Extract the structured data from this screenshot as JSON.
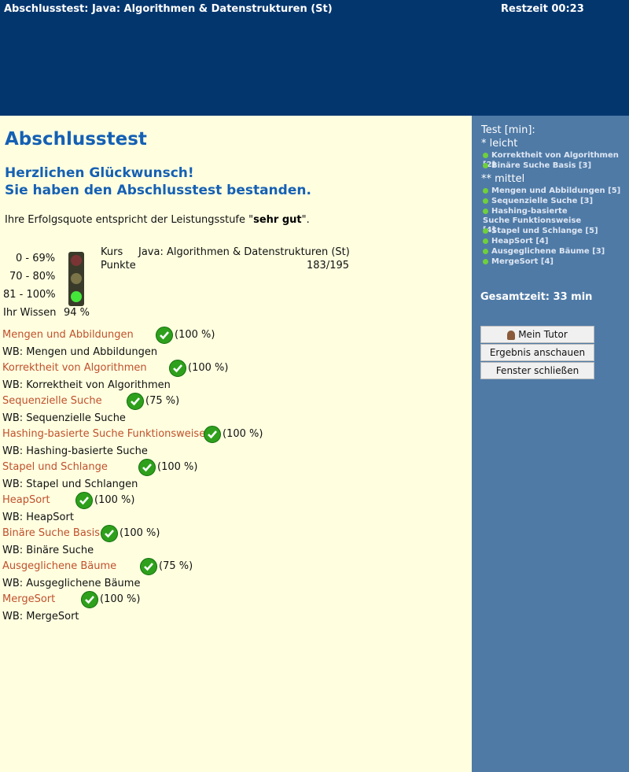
{
  "header": {
    "title": "Abschlusstest: Java: Algorithmen & Datenstrukturen (St)",
    "timer": "Restzeit 00:23"
  },
  "main": {
    "heading": "Abschlusstest",
    "congrats_line1": "Herzlichen Glückwunsch!",
    "congrats_line2": "Sie haben den Abschlusstest bestanden.",
    "quote_prefix": "Ihre Erfolgsquote entspricht der Leistungsstufe \"",
    "quote_level": "sehr gut",
    "quote_suffix": "\".",
    "ranges": [
      "0 - 69%",
      "70 - 80%",
      "81 - 100%"
    ],
    "wissen_label": "Ihr Wissen",
    "wissen_value": "94 %",
    "kurs_label": "Kurs",
    "kurs_value": "Java: Algorithmen & Datenstrukturen (St)",
    "punkte_label": "Punkte",
    "punkte_value": "183/195",
    "results": [
      {
        "topic": "Mengen und Abbildungen",
        "pct": "(100 %)",
        "wb": "WB: Mengen und Abbildungen"
      },
      {
        "topic": "Korrektheit von Algorithmen",
        "pct": "(100 %)",
        "wb": "WB: Korrektheit von Algorithmen"
      },
      {
        "topic": "Sequenzielle Suche",
        "pct": "(75 %)",
        "wb": "WB: Sequenzielle Suche"
      },
      {
        "topic": "Hashing-basierte Suche Funktionsweise",
        "pct": "(100 %)",
        "wb": "WB: Hashing-basierte Suche"
      },
      {
        "topic": "Stapel und Schlange",
        "pct": "(100 %)",
        "wb": "WB: Stapel und Schlangen"
      },
      {
        "topic": "HeapSort",
        "pct": "(100 %)",
        "wb": "WB: HeapSort"
      },
      {
        "topic": "Binäre Suche Basis",
        "pct": "(100 %)",
        "wb": "WB: Binäre Suche"
      },
      {
        "topic": "Ausgeglichene Bäume",
        "pct": "(75 %)",
        "wb": "WB: Ausgeglichene Bäume"
      },
      {
        "topic": "MergeSort",
        "pct": "(100 %)",
        "wb": "WB: MergeSort"
      }
    ]
  },
  "sidebar": {
    "title": "Test [min]:",
    "level_easy": "* leicht",
    "easy_items": [
      "Korrektheit von Algorithmen [2]",
      "Binäre Suche Basis [3]"
    ],
    "level_medium": "** mittel",
    "medium_items": [
      "Mengen und Abbildungen [5]",
      "Sequenzielle Suche [3]",
      "Hashing-basierte Suche Funktionsweise [4]",
      "Stapel und Schlange [5]",
      "HeapSort [4]",
      "Ausgeglichene Bäume [3]",
      "MergeSort [4]"
    ],
    "total": "Gesamtzeit: 33 min",
    "btn_tutor": "Mein Tutor",
    "btn_result": "Ergebnis anschauen",
    "btn_close": "Fenster schließen"
  },
  "colors": {
    "header": "#04366e",
    "sidebar": "#4f7aa6",
    "heading": "#1560b4",
    "link": "#c0502c",
    "check": "#2ea01c"
  }
}
